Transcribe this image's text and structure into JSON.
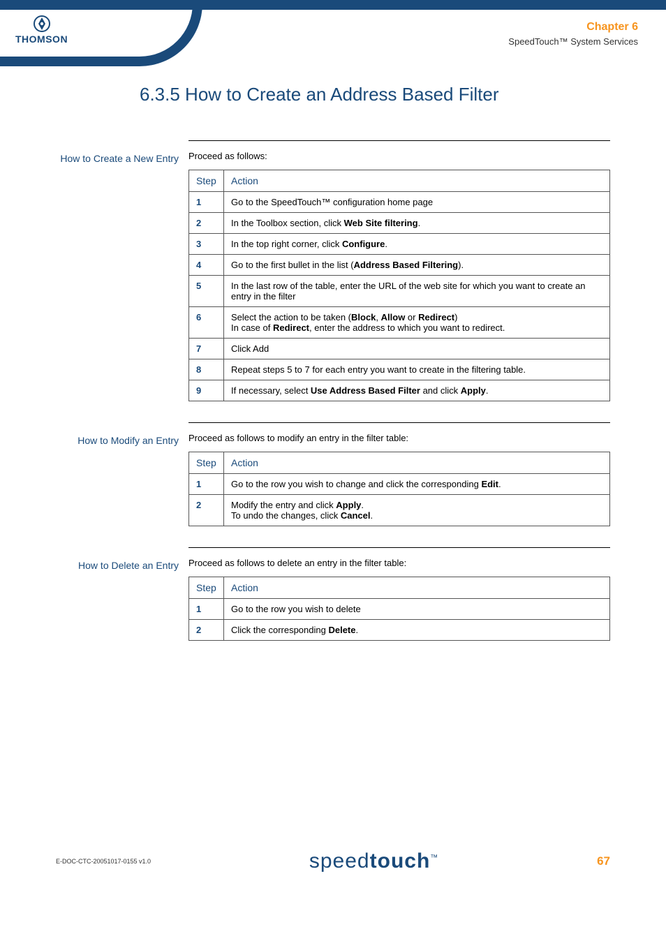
{
  "header": {
    "logo_brand": "THOMSON",
    "chapter_label": "Chapter 6",
    "chapter_title": "SpeedTouch™ System Services"
  },
  "page": {
    "title": "6.3.5  How to Create an Address Based Filter"
  },
  "sections": [
    {
      "label": "How to Create a New Entry",
      "intro": "Proceed as follows:",
      "columns": [
        "Step",
        "Action"
      ],
      "rows": [
        {
          "step": "1",
          "action_html": "Go to the SpeedTouch™ configuration home page"
        },
        {
          "step": "2",
          "action_html": "In the Toolbox section, click <b>Web Site filtering</b>."
        },
        {
          "step": "3",
          "action_html": "In the top right corner, click <b>Configure</b>."
        },
        {
          "step": "4",
          "action_html": "Go to the first bullet in the list (<b>Address Based Filtering</b>)."
        },
        {
          "step": "5",
          "action_html": "In the last row of the table, enter the URL of the web site for which you want to create an entry in the filter"
        },
        {
          "step": "6",
          "action_html": "Select the action to be taken (<b>Block</b>, <b>Allow</b> or <b>Redirect</b>)<br>In case of <b>Redirect</b>, enter the address to which you want to redirect."
        },
        {
          "step": "7",
          "action_html": "Click Add"
        },
        {
          "step": "8",
          "action_html": "Repeat steps 5 to 7 for each entry you want to create in the filtering table."
        },
        {
          "step": "9",
          "action_html": "If necessary, select <b>Use Address Based Filter</b> and click <b>Apply</b>."
        }
      ]
    },
    {
      "label": "How to Modify an Entry",
      "intro": "Proceed as follows to modify an entry in the filter table:",
      "columns": [
        "Step",
        "Action"
      ],
      "rows": [
        {
          "step": "1",
          "action_html": "Go to the row you wish to change and click the corresponding <b>Edit</b>."
        },
        {
          "step": "2",
          "action_html": "Modify the entry and click <b>Apply</b>.<br>To undo the changes, click <b>Cancel</b>."
        }
      ]
    },
    {
      "label": "How to Delete an Entry",
      "intro": "Proceed as follows to delete an entry in the filter table:",
      "columns": [
        "Step",
        "Action"
      ],
      "rows": [
        {
          "step": "1",
          "action_html": "Go to the row you wish to delete"
        },
        {
          "step": "2",
          "action_html": "Click the corresponding <b>Delete</b>."
        }
      ]
    }
  ],
  "footer": {
    "doc_id": "E-DOC-CTC-20051017-0155 v1.0",
    "brand_light": "speed",
    "brand_bold": "touch",
    "brand_tm": "™",
    "page_number": "67"
  }
}
